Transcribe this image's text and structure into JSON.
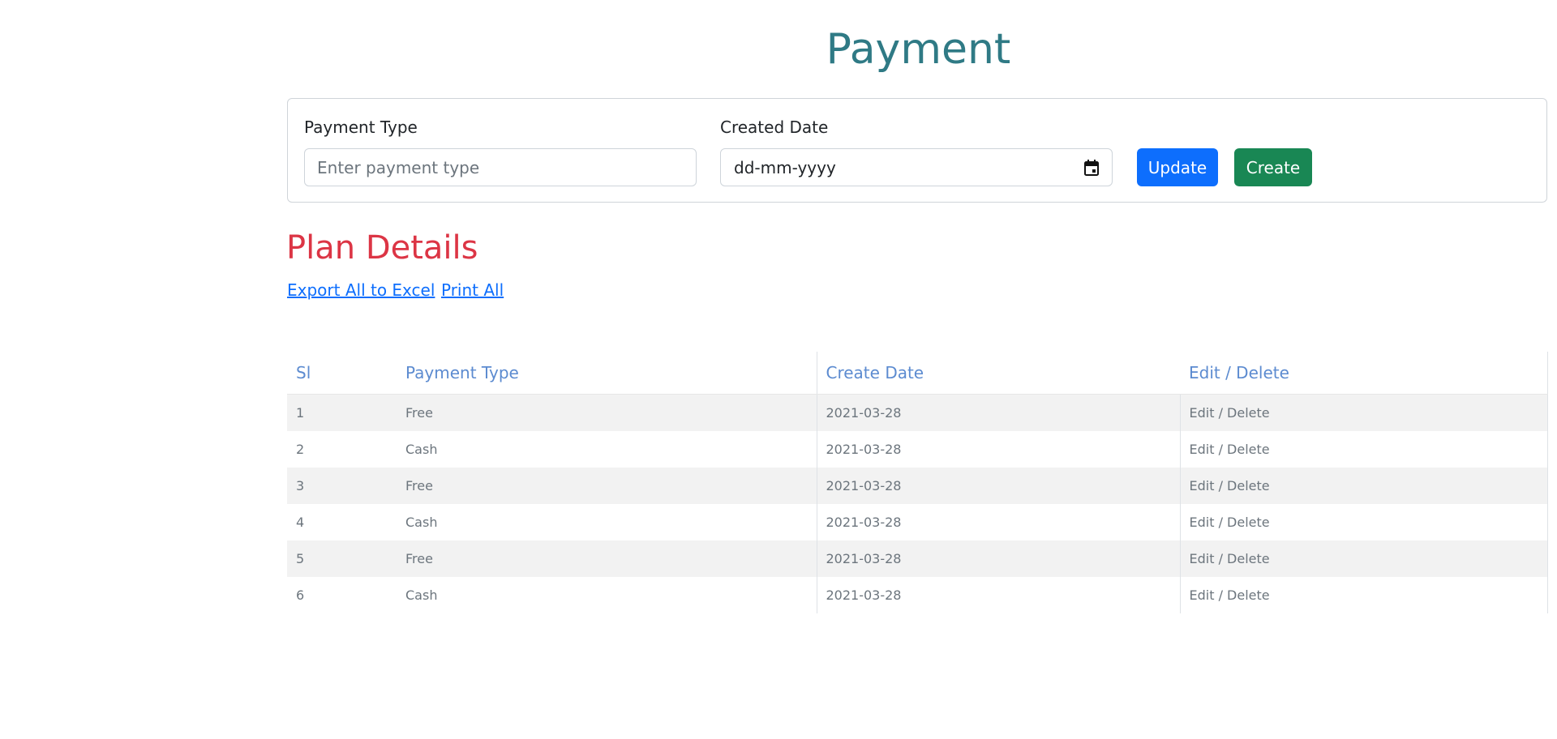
{
  "page": {
    "title": "Payment"
  },
  "form": {
    "payment_type_label": "Payment Type",
    "payment_type_placeholder": "Enter payment type",
    "payment_type_value": "",
    "created_date_label": "Created Date",
    "created_date_value": "dd-mm-yyyy",
    "update_label": "Update",
    "create_label": "Create"
  },
  "plan": {
    "title": "Plan Details",
    "export_link": "Export All to Excel",
    "print_link": "Print All"
  },
  "table": {
    "headers": [
      "Sl",
      "Payment Type",
      "Create Date",
      "Edit / Delete"
    ],
    "rows": [
      {
        "sl": "1",
        "type": "Free",
        "date": "2021-03-28",
        "action": "Edit / Delete"
      },
      {
        "sl": "2",
        "type": "Cash",
        "date": "2021-03-28",
        "action": "Edit / Delete"
      },
      {
        "sl": "3",
        "type": "Free",
        "date": "2021-03-28",
        "action": "Edit / Delete"
      },
      {
        "sl": "4",
        "type": "Cash",
        "date": "2021-03-28",
        "action": "Edit / Delete"
      },
      {
        "sl": "5",
        "type": "Free",
        "date": "2021-03-28",
        "action": "Edit / Delete"
      },
      {
        "sl": "6",
        "type": "Cash",
        "date": "2021-03-28",
        "action": "Edit / Delete"
      }
    ]
  },
  "colors": {
    "title": "#2f7a85",
    "section_title": "#dc3545",
    "update_button": "#0d6efd",
    "create_button": "#198754",
    "link": "#0d6efd",
    "table_header": "#5c8bd0"
  },
  "icons": {
    "date_picker": "calendar-icon"
  }
}
